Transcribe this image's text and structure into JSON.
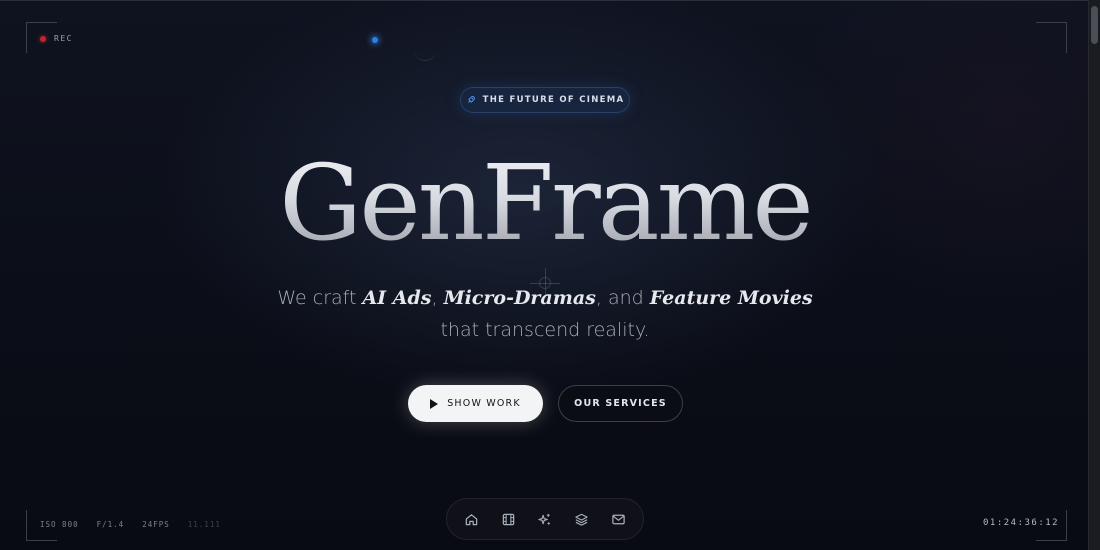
{
  "hud": {
    "rec_label": "REC",
    "stats": [
      "ISO 800",
      "F/1.4",
      "24FPS",
      "11.111"
    ],
    "timecode": "01:24:36:12"
  },
  "badge": {
    "label": "THE FUTURE OF CINEMA",
    "icon": "rocket-icon"
  },
  "hero": {
    "title": "GenFrame",
    "tagline": {
      "prefix": "We craft ",
      "item1": "AI Ads",
      "sep1": ", ",
      "item2": "Micro-Dramas",
      "sep2": ", and ",
      "item3": "Feature Movies",
      "line2": "that transcend reality."
    }
  },
  "buttons": {
    "show_work": "SHOW WORK",
    "our_services": "OUR SERVICES"
  },
  "dock": {
    "items": [
      "home-icon",
      "film-icon",
      "sparkles-icon",
      "layers-icon",
      "mail-icon"
    ]
  },
  "colors": {
    "background": "#0b0d14",
    "rec": "#c0262b",
    "accent_glow": "#2f7fe0",
    "primary_button": "#f3f4f6"
  }
}
